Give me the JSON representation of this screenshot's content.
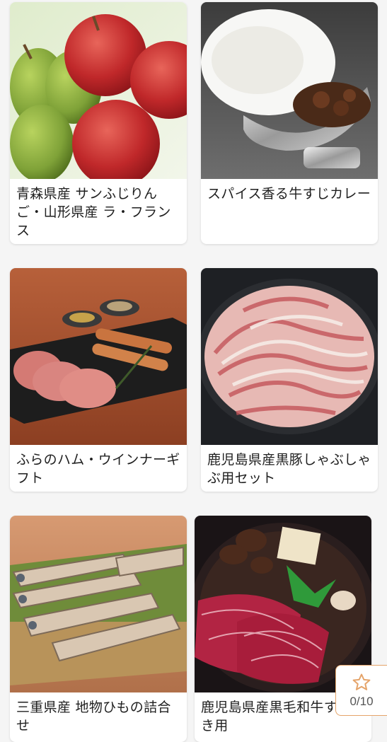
{
  "products": [
    {
      "title": "青森県産 サンふじりんご・山形県産 ラ・フランス",
      "image": "apples-and-pears-photo"
    },
    {
      "title": "スパイス香る牛すじカレー",
      "image": "beef-curry-photo"
    },
    {
      "title": "ふらのハム・ウインナーギフト",
      "image": "ham-and-sausage-photo"
    },
    {
      "title": "鹿児島県産黒豚しゃぶしゃぶ用セット",
      "image": "pork-shabu-photo"
    },
    {
      "title": "三重県産 地物ひもの詰合せ",
      "image": "dried-fish-photo"
    },
    {
      "title": "鹿児島県産黒毛和牛すき焼き用",
      "image": "wagyu-sukiyaki-photo"
    }
  ],
  "favorites": {
    "count": "0/10",
    "icon": "star-icon"
  },
  "colors": {
    "accent": "#e5a46a",
    "card_bg": "#ffffff",
    "page_bg": "#f5f5f5"
  }
}
